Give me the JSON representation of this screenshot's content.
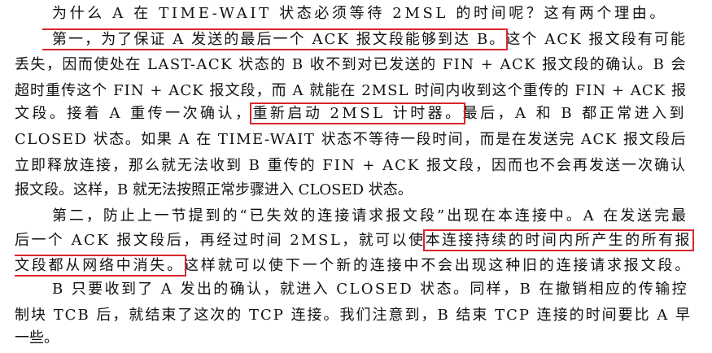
{
  "lines": [
    {
      "parts": [
        "为什么 A 在 TIME-WAIT 状态必须等待 2MSL 的时间呢？这有两个理由。"
      ]
    },
    {
      "parts": [
        "第一，为了保证 A 发送的最后一个 ACK 报文段能够到达 B。",
        "这个 ACK 报文段有可能"
      ]
    },
    {
      "parts": [
        "丢失，因而使处在 LAST-ACK 状态的 B 收不到对已发送的 FIN + ACK 报文段的确认。B 会"
      ]
    },
    {
      "parts": [
        "超时重传这个 FIN + ACK 报文段，而 A 就能在 2MSL 时间内收到这个重传的 FIN + ACK 报"
      ]
    },
    {
      "parts": [
        "文段。接着 A 重传一次确认，",
        "重新启动 2MSL 计时器。",
        "最后，A 和 B 都正常进入到"
      ]
    },
    {
      "parts": [
        "CLOSED 状态。如果 A 在 TIME-WAIT 状态不等待一段时间，而是在发送完 ACK 报文段后"
      ]
    },
    {
      "parts": [
        "立即释放连接，那么就无法收到 B 重传的 FIN + ACK 报文段，因而也不会再发送一次确认"
      ]
    },
    {
      "parts": [
        "报文段。这样，B 就无法按照正常步骤进入 CLOSED 状态。"
      ]
    },
    {
      "parts": [
        "第二，防止上一节提到的“已失效的连接请求报文段”出现在本连接中。A 在发送完最"
      ]
    },
    {
      "parts": [
        "后一个 ACK 报文段后，再经过时间 2MSL，就可以使",
        "本连接持续的时间内所产生的所有报"
      ]
    },
    {
      "parts": [
        "文段都从网络中消失。",
        "这样就可以使下一个新的连接中不会出现这种旧的连接请求报文段。"
      ]
    },
    {
      "parts": [
        "B 只要收到了 A 发出的确认，就进入 CLOSED 状态。同样，B 在撤销相应的传输控"
      ]
    },
    {
      "parts": [
        "制块 TCB 后，就结束了这次的 TCP 连接。我们注意到，B 结束 TCP 连接的时间要比 A 早"
      ]
    },
    {
      "parts": [
        "一些。"
      ]
    }
  ],
  "colors": {
    "text": "#111111",
    "highlight_box": "#d9262c",
    "background": "#ffffff"
  }
}
